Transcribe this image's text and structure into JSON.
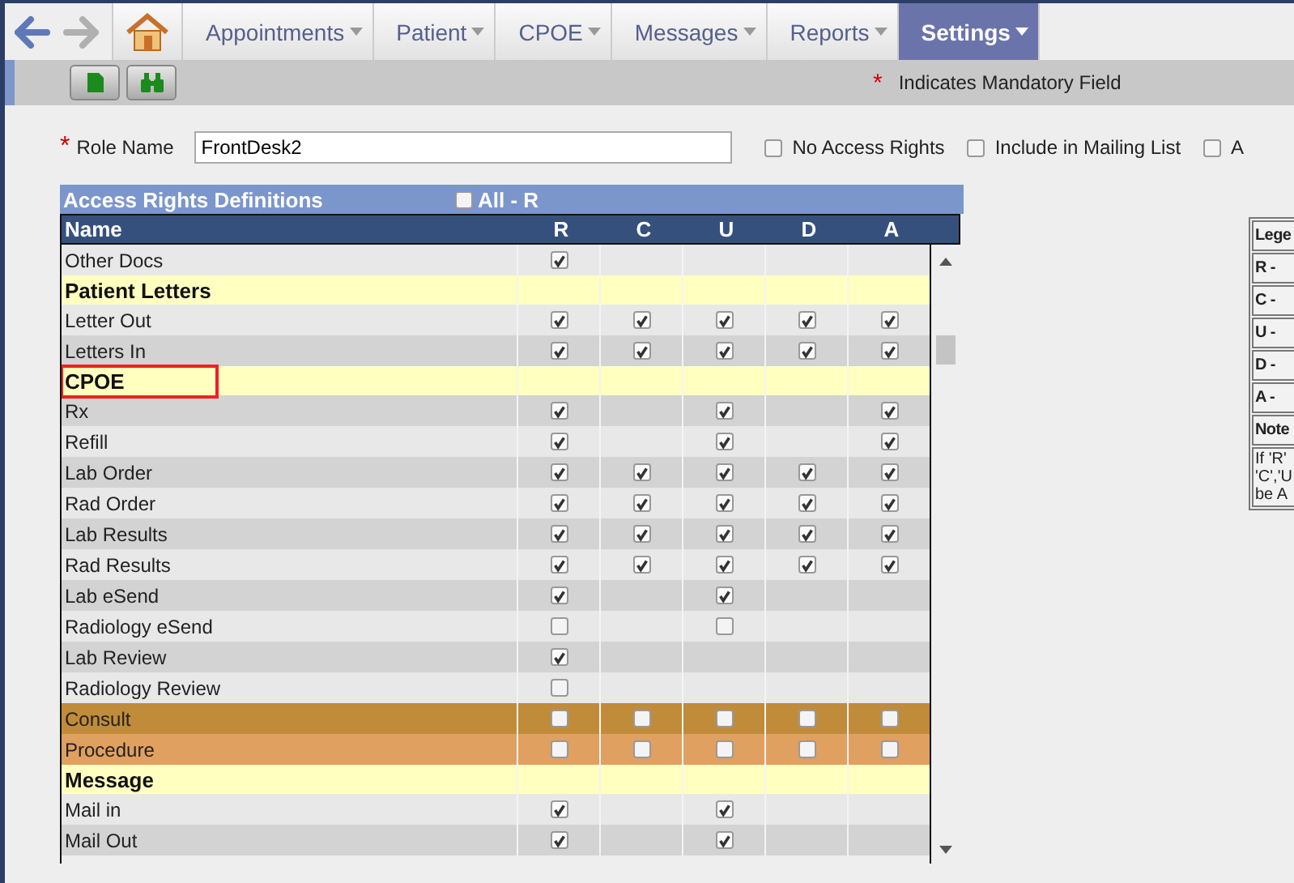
{
  "nav": {
    "tabs": [
      {
        "label": "Appointments",
        "selected": false
      },
      {
        "label": "Patient",
        "selected": false
      },
      {
        "label": "CPOE",
        "selected": false
      },
      {
        "label": "Messages",
        "selected": false
      },
      {
        "label": "Reports",
        "selected": false
      },
      {
        "label": "Settings",
        "selected": true
      }
    ]
  },
  "toolbar": {
    "mandatory_mark": "*",
    "mandatory_note": "Indicates Mandatory Field"
  },
  "form": {
    "required_mark": "*",
    "role_label": "Role Name",
    "role_value": "FrontDesk2",
    "options": [
      {
        "label": "No Access Rights",
        "checked": false
      },
      {
        "label": "Include in Mailing List",
        "checked": false
      },
      {
        "label": "A",
        "checked": false
      }
    ]
  },
  "table": {
    "title": "Access Rights Definitions",
    "all_label": "All - R",
    "all_checked": false,
    "columns": [
      "Name",
      "R",
      "C",
      "U",
      "D",
      "A"
    ],
    "rows": [
      {
        "kind": "item",
        "name": "Other Docs",
        "highlighted": false,
        "cells": [
          {
            "kind": "checkbox",
            "checked": true
          },
          {
            "kind": "empty"
          },
          {
            "kind": "empty"
          },
          {
            "kind": "empty"
          },
          {
            "kind": "empty"
          }
        ]
      },
      {
        "kind": "section",
        "name": "Patient Letters",
        "outlined": false
      },
      {
        "kind": "item",
        "name": "Letter Out",
        "highlighted": false,
        "cells": [
          {
            "kind": "checkbox",
            "checked": true
          },
          {
            "kind": "checkbox",
            "checked": true
          },
          {
            "kind": "checkbox",
            "checked": true
          },
          {
            "kind": "checkbox",
            "checked": true
          },
          {
            "kind": "checkbox",
            "checked": true
          }
        ]
      },
      {
        "kind": "item",
        "name": "Letters In",
        "highlighted": false,
        "cells": [
          {
            "kind": "checkbox",
            "checked": true
          },
          {
            "kind": "checkbox",
            "checked": true
          },
          {
            "kind": "checkbox",
            "checked": true
          },
          {
            "kind": "checkbox",
            "checked": true
          },
          {
            "kind": "checkbox",
            "checked": true
          }
        ]
      },
      {
        "kind": "section",
        "name": "CPOE",
        "outlined": true
      },
      {
        "kind": "item",
        "name": "Rx",
        "highlighted": false,
        "cells": [
          {
            "kind": "checkbox",
            "checked": true
          },
          {
            "kind": "empty"
          },
          {
            "kind": "checkbox",
            "checked": true
          },
          {
            "kind": "empty"
          },
          {
            "kind": "checkbox",
            "checked": true
          }
        ]
      },
      {
        "kind": "item",
        "name": "Refill",
        "highlighted": false,
        "cells": [
          {
            "kind": "checkbox",
            "checked": true
          },
          {
            "kind": "empty"
          },
          {
            "kind": "checkbox",
            "checked": true
          },
          {
            "kind": "empty"
          },
          {
            "kind": "checkbox",
            "checked": true
          }
        ]
      },
      {
        "kind": "item",
        "name": "Lab Order",
        "highlighted": false,
        "cells": [
          {
            "kind": "checkbox",
            "checked": true
          },
          {
            "kind": "checkbox",
            "checked": true
          },
          {
            "kind": "checkbox",
            "checked": true
          },
          {
            "kind": "checkbox",
            "checked": true
          },
          {
            "kind": "checkbox",
            "checked": true
          }
        ]
      },
      {
        "kind": "item",
        "name": "Rad Order",
        "highlighted": false,
        "cells": [
          {
            "kind": "checkbox",
            "checked": true
          },
          {
            "kind": "checkbox",
            "checked": true
          },
          {
            "kind": "checkbox",
            "checked": true
          },
          {
            "kind": "checkbox",
            "checked": true
          },
          {
            "kind": "checkbox",
            "checked": true
          }
        ]
      },
      {
        "kind": "item",
        "name": "Lab Results",
        "highlighted": false,
        "cells": [
          {
            "kind": "checkbox",
            "checked": true
          },
          {
            "kind": "checkbox",
            "checked": true
          },
          {
            "kind": "checkbox",
            "checked": true
          },
          {
            "kind": "checkbox",
            "checked": true
          },
          {
            "kind": "checkbox",
            "checked": true
          }
        ]
      },
      {
        "kind": "item",
        "name": "Rad Results",
        "highlighted": false,
        "cells": [
          {
            "kind": "checkbox",
            "checked": true
          },
          {
            "kind": "checkbox",
            "checked": true
          },
          {
            "kind": "checkbox",
            "checked": true
          },
          {
            "kind": "checkbox",
            "checked": true
          },
          {
            "kind": "checkbox",
            "checked": true
          }
        ]
      },
      {
        "kind": "item",
        "name": "Lab eSend",
        "highlighted": false,
        "cells": [
          {
            "kind": "checkbox",
            "checked": true
          },
          {
            "kind": "empty"
          },
          {
            "kind": "checkbox",
            "checked": true
          },
          {
            "kind": "empty"
          },
          {
            "kind": "empty"
          }
        ]
      },
      {
        "kind": "item",
        "name": "Radiology eSend",
        "highlighted": false,
        "cells": [
          {
            "kind": "checkbox",
            "checked": false
          },
          {
            "kind": "empty"
          },
          {
            "kind": "checkbox",
            "checked": false
          },
          {
            "kind": "empty"
          },
          {
            "kind": "empty"
          }
        ]
      },
      {
        "kind": "item",
        "name": "Lab Review",
        "highlighted": false,
        "cells": [
          {
            "kind": "checkbox",
            "checked": true
          },
          {
            "kind": "empty"
          },
          {
            "kind": "empty"
          },
          {
            "kind": "empty"
          },
          {
            "kind": "empty"
          }
        ]
      },
      {
        "kind": "item",
        "name": "Radiology Review",
        "highlighted": false,
        "cells": [
          {
            "kind": "checkbox",
            "checked": false
          },
          {
            "kind": "empty"
          },
          {
            "kind": "empty"
          },
          {
            "kind": "empty"
          },
          {
            "kind": "empty"
          }
        ]
      },
      {
        "kind": "item",
        "name": "Consult",
        "highlighted": true,
        "cells": [
          {
            "kind": "checkbox",
            "checked": false
          },
          {
            "kind": "checkbox",
            "checked": false
          },
          {
            "kind": "checkbox",
            "checked": false
          },
          {
            "kind": "checkbox",
            "checked": false
          },
          {
            "kind": "checkbox",
            "checked": false
          }
        ]
      },
      {
        "kind": "item",
        "name": "Procedure",
        "highlighted": true,
        "cells": [
          {
            "kind": "checkbox",
            "checked": false
          },
          {
            "kind": "checkbox",
            "checked": false
          },
          {
            "kind": "checkbox",
            "checked": false
          },
          {
            "kind": "checkbox",
            "checked": false
          },
          {
            "kind": "checkbox",
            "checked": false
          }
        ]
      },
      {
        "kind": "section",
        "name": "Message",
        "outlined": false
      },
      {
        "kind": "item",
        "name": "Mail in",
        "highlighted": false,
        "cells": [
          {
            "kind": "checkbox",
            "checked": true
          },
          {
            "kind": "empty"
          },
          {
            "kind": "checkbox",
            "checked": true
          },
          {
            "kind": "empty"
          },
          {
            "kind": "empty"
          }
        ]
      },
      {
        "kind": "item",
        "name": "Mail Out",
        "highlighted": false,
        "cells": [
          {
            "kind": "checkbox",
            "checked": true
          },
          {
            "kind": "empty"
          },
          {
            "kind": "checkbox",
            "checked": true
          },
          {
            "kind": "empty"
          },
          {
            "kind": "empty"
          }
        ]
      }
    ]
  },
  "legend": {
    "rows": [
      "Lege",
      "R -",
      "C -",
      "U -",
      "D -",
      "A -",
      "Note"
    ],
    "note_lines": [
      "If 'R'",
      "'C','U",
      "be A"
    ]
  }
}
